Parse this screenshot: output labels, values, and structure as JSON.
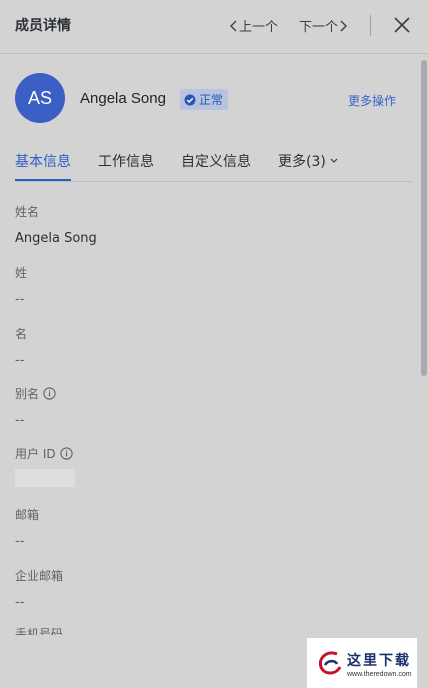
{
  "header": {
    "title": "成员详情",
    "prev_label": "上一个",
    "next_label": "下一个",
    "close_icon": "close-icon"
  },
  "profile": {
    "avatar_initials": "AS",
    "name": "Angela Song",
    "status": "正常",
    "more_actions": "更多操作"
  },
  "tabs": [
    {
      "label": "基本信息",
      "active": true
    },
    {
      "label": "工作信息",
      "active": false
    },
    {
      "label": "自定义信息",
      "active": false
    },
    {
      "label": "更多(3)",
      "active": false
    }
  ],
  "fields": {
    "full_name": {
      "label": "姓名",
      "value": "Angela Song"
    },
    "last_name": {
      "label": "姓",
      "value": "--"
    },
    "first_name": {
      "label": "名",
      "value": "--"
    },
    "alias": {
      "label": "别名",
      "value": "--"
    },
    "user_id": {
      "label": "用户 ID"
    },
    "email": {
      "label": "邮箱",
      "value": "--"
    },
    "work_email": {
      "label": "企业邮箱",
      "value": "--"
    },
    "partial_label": "手机号码"
  },
  "colors": {
    "accent": "#2d5bc7",
    "avatar_bg": "#3b5fc4",
    "overlay_bg": "#d3d3d4"
  },
  "watermark": {
    "text": "这里下载",
    "url": "www.theredown.com"
  }
}
